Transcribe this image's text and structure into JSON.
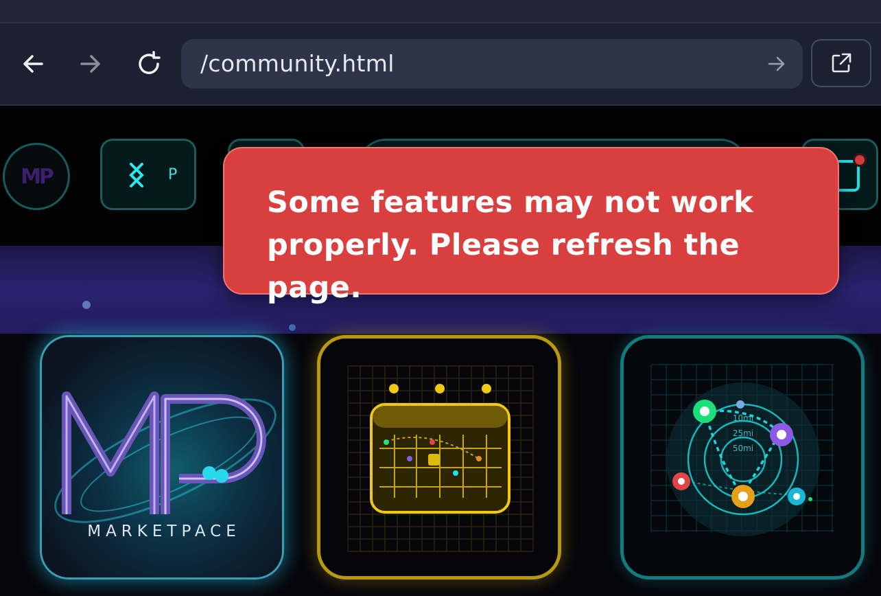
{
  "browser": {
    "url": "/community.html"
  },
  "header": {
    "logo_text": "MP",
    "pill_label": "P"
  },
  "cards": [
    {
      "name": "marketpace-logo-card",
      "brand": "MARKETPACE"
    },
    {
      "name": "calendar-card"
    },
    {
      "name": "radius-map-card",
      "rings": [
        "10mi",
        "25mi",
        "50mi"
      ]
    }
  ],
  "toast": {
    "message": "Some features may not work properly. Please refresh the page.",
    "color": "#da3f3f"
  },
  "colors": {
    "accent_cyan": "#19e2ec",
    "calendar_gold": "#f2c811",
    "map_teal": "#137a7d"
  }
}
